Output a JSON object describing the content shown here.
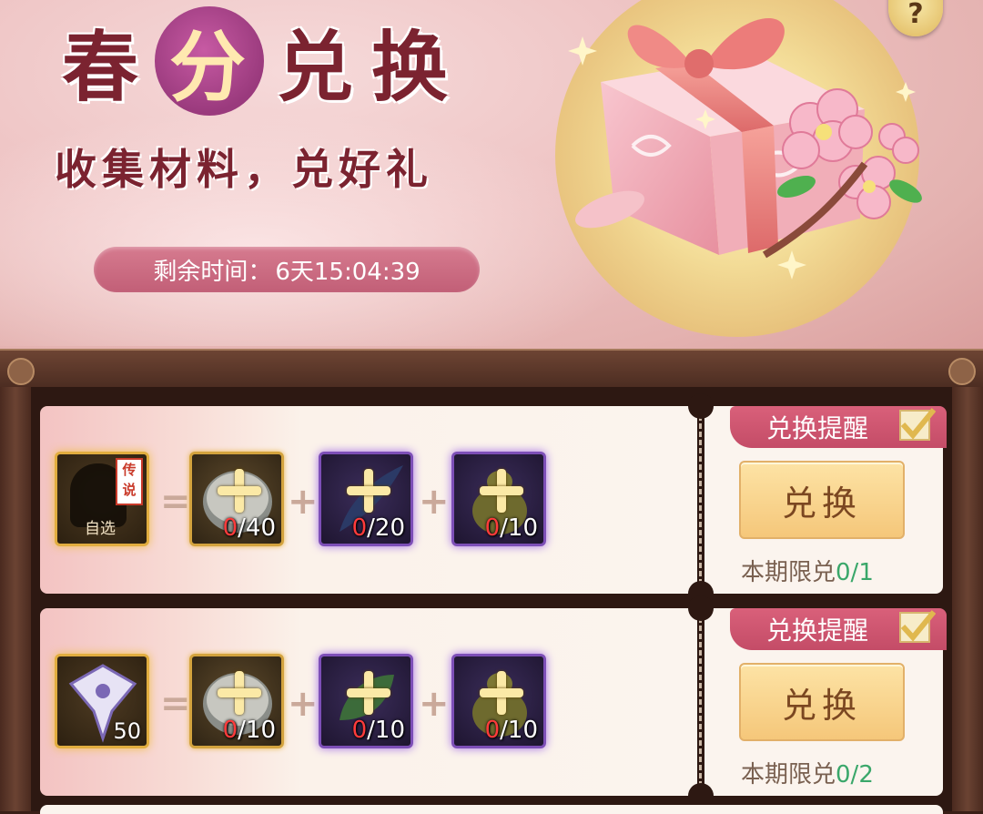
{
  "banner": {
    "title_chars": [
      "春",
      "分",
      "兑",
      "换"
    ],
    "subtitle": "收集材料，兑好礼",
    "timer_label": "剩余时间：",
    "timer_value": "6天15:04:39",
    "help_icon": "?"
  },
  "rows": [
    {
      "reward": {
        "type": "hero-selector",
        "tag": "传说",
        "choice_label": "自选",
        "quantity": ""
      },
      "materials": [
        {
          "icon": "drum-icon",
          "rarity": "gold",
          "current": "0",
          "required": "/40"
        },
        {
          "icon": "feather-icon",
          "rarity": "purple",
          "current": "0",
          "required": "/20"
        },
        {
          "icon": "gourd-icon",
          "rarity": "purple",
          "current": "0",
          "required": "/10"
        }
      ],
      "remind_label": "兑换提醒",
      "remind_checked": true,
      "button_label": "兑换",
      "limit_label": "本期限兑",
      "limit_value": "0/1"
    },
    {
      "reward": {
        "type": "kite",
        "tag": "",
        "choice_label": "",
        "quantity": "50"
      },
      "materials": [
        {
          "icon": "drum-icon",
          "rarity": "gold",
          "current": "0",
          "required": "/10"
        },
        {
          "icon": "leaf-icon",
          "rarity": "purple",
          "current": "0",
          "required": "/10"
        },
        {
          "icon": "gourd-icon",
          "rarity": "purple",
          "current": "0",
          "required": "/10"
        }
      ],
      "remind_label": "兑换提醒",
      "remind_checked": true,
      "button_label": "兑换",
      "limit_label": "本期限兑",
      "limit_value": "0/2"
    }
  ],
  "operators": {
    "equals": "=",
    "plus": "+"
  },
  "colors": {
    "accent_pink": "#c44c67",
    "count_red": "#ff3b3b",
    "limit_green": "#3aa76a",
    "button_gold": "#f5c77a"
  }
}
